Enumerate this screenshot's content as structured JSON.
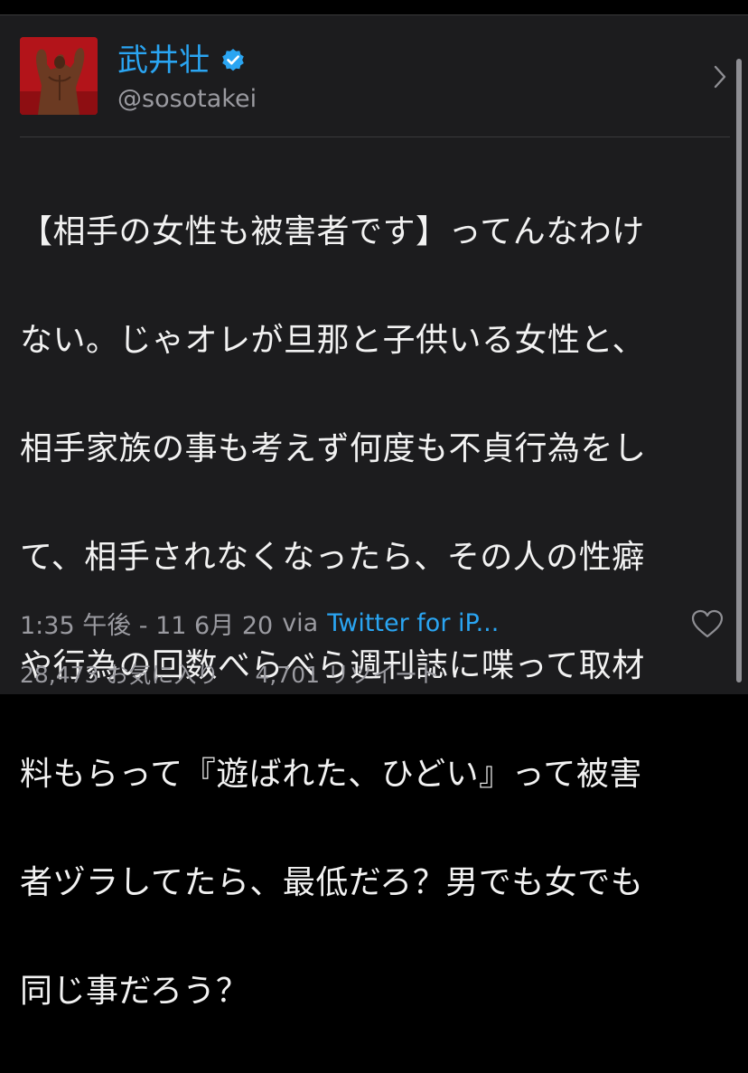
{
  "user": {
    "display_name": "武井壮",
    "handle": "@sosotakei",
    "verified": true
  },
  "tweet": {
    "lines": [
      "【相手の女性も被害者です】ってんなわけ",
      "ない。じゃオレが旦那と子供いる女性と、",
      "相手家族の事も考えず何度も不貞行為をし",
      "て、相手されなくなったら、その人の性癖",
      "や行為の回数べらべら週刊誌に喋って取材",
      "料もらって『遊ばれた、ひどい』って被害",
      "者ヅラしてたら、最低だろ？男でも女でも",
      "同じ事だろう？"
    ],
    "timestamp": "1:35 午後 - 11 6月 20",
    "via_label": "via",
    "source": "Twitter for iP..."
  },
  "stats": {
    "likes": "28,473 お気に入り",
    "retweets": "4,701 リツイート"
  },
  "icons": {
    "verified": "verified-badge-icon",
    "chevron": "chevron-right-icon",
    "like": "heart-icon"
  },
  "colors": {
    "accent": "#2aa5f2",
    "background": "#1c1c1e",
    "text": "#f2f2f2",
    "secondary": "#9a9aa0"
  }
}
